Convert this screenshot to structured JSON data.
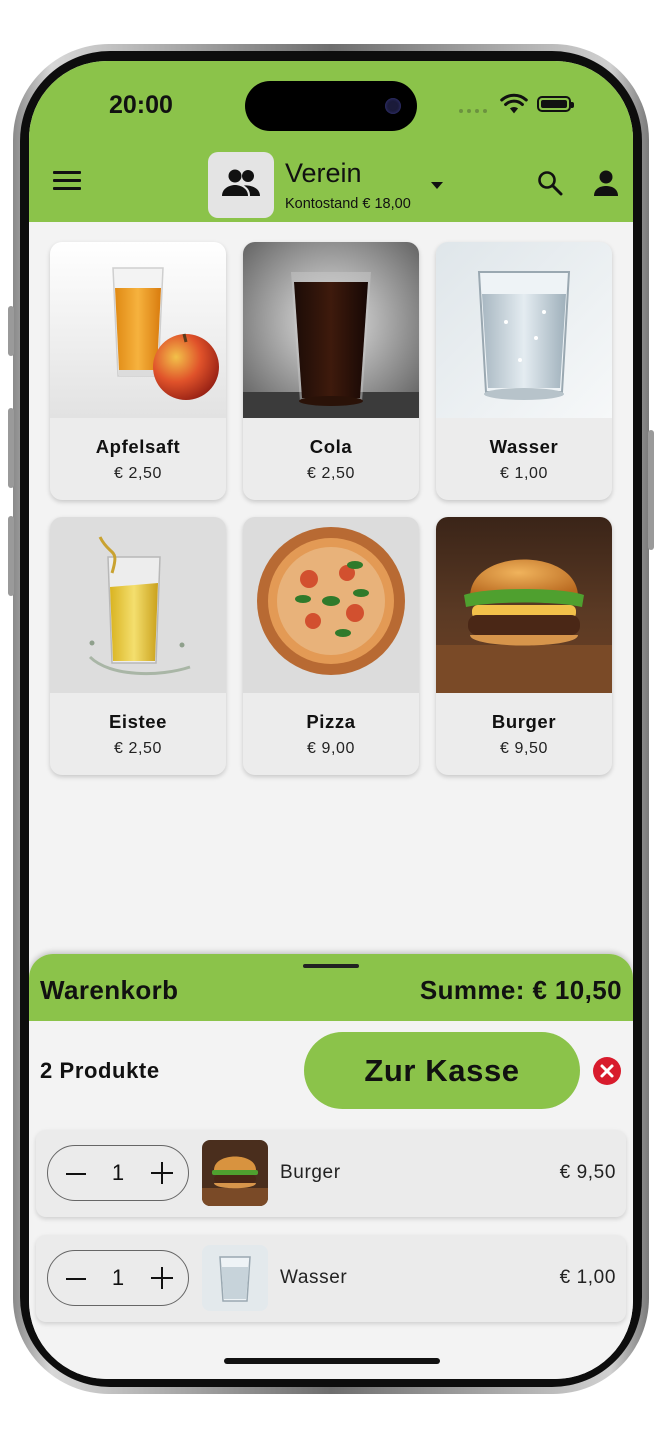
{
  "status_bar": {
    "time": "20:00"
  },
  "header": {
    "group_name": "Verein",
    "balance": "Kontostand € 18,00",
    "icons": [
      "menu-icon",
      "group-icon",
      "caret-down-icon",
      "search-icon",
      "account-icon"
    ]
  },
  "products": [
    {
      "name": "Apfelsaft",
      "price": "€ 2,50"
    },
    {
      "name": "Cola",
      "price": "€ 2,50"
    },
    {
      "name": "Wasser",
      "price": "€ 1,00"
    },
    {
      "name": "Eistee",
      "price": "€ 2,50"
    },
    {
      "name": "Pizza",
      "price": "€ 9,00"
    },
    {
      "name": "Burger",
      "price": "€ 9,50"
    }
  ],
  "cart": {
    "title": "Warenkorb",
    "sum": "Summe: € 10,50",
    "count": "2 Produkte",
    "checkout_label": "Zur Kasse",
    "items": [
      {
        "qty": "1",
        "name": "Burger",
        "price": "€ 9,50"
      },
      {
        "qty": "1",
        "name": "Wasser",
        "price": "€ 1,00"
      }
    ]
  },
  "colors": {
    "accent": "#8bc34a",
    "clear": "#d81b2c",
    "background": "#f3f3f3"
  }
}
